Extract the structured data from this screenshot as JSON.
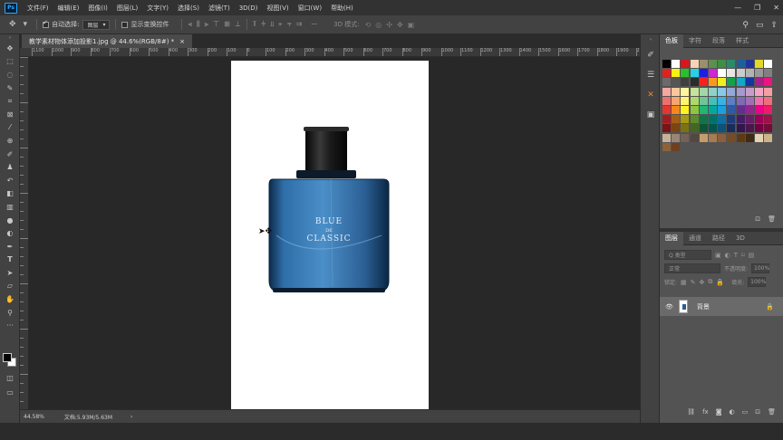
{
  "app": {
    "logo": "Ps"
  },
  "menu": [
    "文件(F)",
    "编辑(E)",
    "图像(I)",
    "图层(L)",
    "文字(Y)",
    "选择(S)",
    "滤镜(T)",
    "3D(D)",
    "视图(V)",
    "窗口(W)",
    "帮助(H)"
  ],
  "window_controls": {
    "minimize": "—",
    "restore": "❐",
    "close": "✕"
  },
  "options": {
    "auto_select_label": "自动选择:",
    "auto_select_value": "图层",
    "show_transform_label": "显示变换控件",
    "more": "···",
    "mode_3d_label": "3D 模式:"
  },
  "document": {
    "tab_title": "教学素材物体添加投影1.jpg @ 44.6%(RGB/8#) *",
    "close_label": "×"
  },
  "ruler_h": [
    "1100",
    "1000",
    "900",
    "800",
    "700",
    "600",
    "500",
    "400",
    "300",
    "200",
    "100",
    "0",
    "100",
    "200",
    "300",
    "400",
    "500",
    "600",
    "700",
    "800",
    "900",
    "1000",
    "1100",
    "1200",
    "1300",
    "1400",
    "1500",
    "1600",
    "1700",
    "1800",
    "1900",
    "2000"
  ],
  "bottle": {
    "line1": "BLUE",
    "line2": "DE",
    "line3": "CLASSIC"
  },
  "status": {
    "zoom": "44.58%",
    "doc_info": "文档:5.93M/5.63M",
    "arrow": "›"
  },
  "swatches": {
    "tabs": [
      "色板",
      "字符",
      "段落",
      "样式"
    ],
    "colors": [
      "#000000",
      "#ffffff",
      "#d9161c",
      "#f7d2b4",
      "#9b8f6d",
      "#5d8f4e",
      "#3e8e45",
      "#2a8a6c",
      "#1d5f9a",
      "#22349a",
      "#e2d826",
      "#ffffff",
      "#e41f1f",
      "#f6f314",
      "#2bbf2b",
      "#27d0e7",
      "#1c1fe1",
      "#cf25d8",
      "#ffffff",
      "#e6e6e6",
      "#cccccc",
      "#b3b3b3",
      "#999999",
      "#808080",
      "#6b6b6b",
      "#555555",
      "#404040",
      "#2b2b2b",
      "#f4231d",
      "#f99a1c",
      "#f1ee22",
      "#12a24d",
      "#12a9c7",
      "#1535a3",
      "#a71f88",
      "#e8167d",
      "#f4a8a0",
      "#fbc79b",
      "#fff59d",
      "#c7e29a",
      "#a4d7a7",
      "#8fd2c7",
      "#8ac8e8",
      "#93a9d7",
      "#a799cd",
      "#c99dc9",
      "#f3a5c8",
      "#f3a0a3",
      "#ef6f6a",
      "#f8a56f",
      "#fff46b",
      "#add86b",
      "#6fc49a",
      "#47bfb6",
      "#3cb1e6",
      "#5b7ec4",
      "#7e6bb5",
      "#a46db5",
      "#ee72aa",
      "#ef6e7c",
      "#e5352c",
      "#f3881d",
      "#fff21d",
      "#8dc63f",
      "#22b573",
      "#00a99d",
      "#1b9fe0",
      "#2e5aa8",
      "#662d91",
      "#93278f",
      "#ec008c",
      "#ed1c6a",
      "#a21c1d",
      "#a45d18",
      "#a69a14",
      "#5c8b2a",
      "#13724a",
      "#007368",
      "#116ea3",
      "#1f3b78",
      "#441d66",
      "#661e66",
      "#9c0058",
      "#9d1247",
      "#7a1313",
      "#7b4511",
      "#7c7310",
      "#44671f",
      "#0e5537",
      "#00564e",
      "#0c5279",
      "#172c59",
      "#32154c",
      "#4b164b",
      "#730042",
      "#740d35",
      "#c7b299",
      "#998675",
      "#736357",
      "#534741",
      "#c69c6d",
      "#a67c52",
      "#8b5e3c",
      "#754c24",
      "#603913",
      "#3f2a14",
      "#e6d3b3",
      "#cbb38c",
      "#8c6239",
      "#6d4120"
    ]
  },
  "layers": {
    "tabs": [
      "图层",
      "通道",
      "路径",
      "3D"
    ],
    "kind_placeholder": "Q 类型",
    "blend_mode": "正常",
    "opacity_label": "不透明度:",
    "opacity_value": "100%",
    "lock_label": "锁定:",
    "fill_label": "填充:",
    "fill_value": "100%",
    "layer_name": "背景"
  }
}
